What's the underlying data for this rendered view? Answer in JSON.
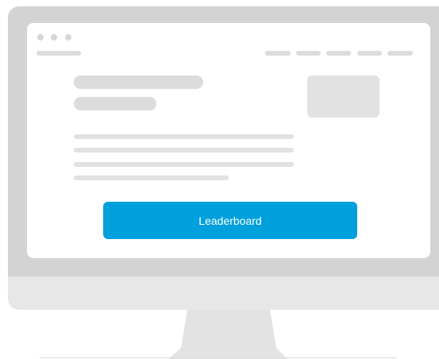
{
  "screen": {
    "cta_label": "Leaderboard"
  },
  "colors": {
    "accent": "#00a0dc",
    "bezel": "#d3d3d3",
    "chin": "#e7e7e7",
    "placeholder": "#dcdcdc"
  }
}
